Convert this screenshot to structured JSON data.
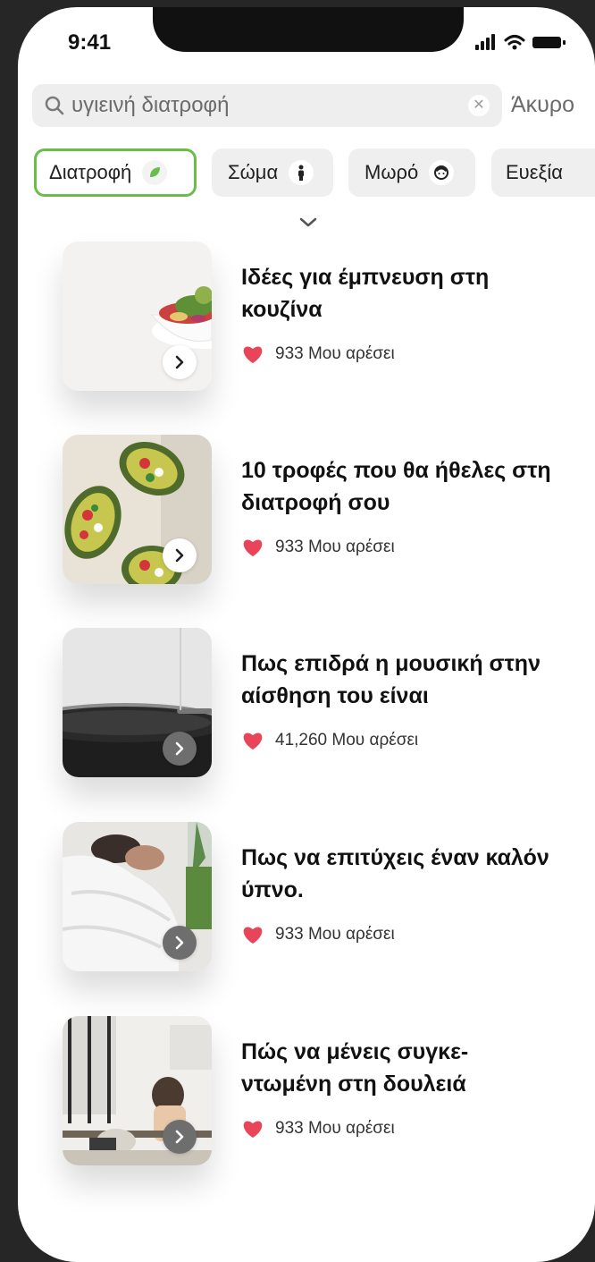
{
  "status_bar": {
    "time": "9:41"
  },
  "search": {
    "query": "υγιεινή διατροφή",
    "cancel_label": "Άκυρο"
  },
  "categories": [
    {
      "label": "Διατροφή",
      "icon": "leaf-icon",
      "active": true
    },
    {
      "label": "Σώμα",
      "icon": "person-icon",
      "active": false
    },
    {
      "label": "Μωρό",
      "icon": "baby-face-icon",
      "active": false
    },
    {
      "label": "Ευεξία",
      "icon": "",
      "active": false
    }
  ],
  "articles": [
    {
      "title": "Ιδέες για έμπνευση στη κουζίνα",
      "likes": "933 Μου αρέσει",
      "image": "salad-bowl-photo"
    },
    {
      "title": "10 τροφές που θα ήθελες στη διατροφή σου",
      "likes": "933 Μου αρέσει",
      "image": "stuffed-avocado-photo"
    },
    {
      "title": "Πως επιδρά η μουσική στην αίσθηση του είναι",
      "likes": "41,260 Μου αρέσει",
      "image": "record-player-photo"
    },
    {
      "title": "Πως να επιτύχεις έναν καλόν ύπνο.",
      "likes": "933 Μου αρέσει",
      "image": "sleeping-bed-photo"
    },
    {
      "title": "Πώς να μένεις συγκε-ντωμένη στη δουλειά",
      "likes": "933 Μου αρέσει",
      "image": "office-work-photo"
    }
  ],
  "colors": {
    "accent_green": "#6abd4b",
    "heart_red": "#e8455a",
    "chip_bg": "#efefef"
  }
}
